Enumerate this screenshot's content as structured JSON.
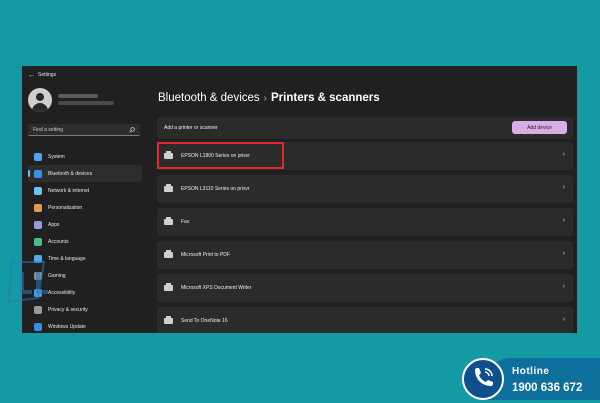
{
  "window": {
    "title": "Settings",
    "back_icon": "←"
  },
  "sidebar": {
    "search_placeholder": "Find a setting",
    "items": [
      {
        "label": "System",
        "icon_color": "#4fa3f7"
      },
      {
        "label": "Bluetooth & devices",
        "icon_color": "#3a8ee6",
        "active": true
      },
      {
        "label": "Network & internet",
        "icon_color": "#6ec0f5"
      },
      {
        "label": "Personalization",
        "icon_color": "#e59a4a"
      },
      {
        "label": "Apps",
        "icon_color": "#9a9ad8"
      },
      {
        "label": "Accounts",
        "icon_color": "#45c08b"
      },
      {
        "label": "Time & language",
        "icon_color": "#57a8e8"
      },
      {
        "label": "Gaming",
        "icon_color": "#8c8c8c"
      },
      {
        "label": "Accessibility",
        "icon_color": "#4d9de0"
      },
      {
        "label": "Privacy & security",
        "icon_color": "#9a9a9a"
      },
      {
        "label": "Windows Update",
        "icon_color": "#2f8fe0"
      }
    ]
  },
  "main": {
    "breadcrumb_parent": "Bluetooth & devices",
    "breadcrumb_separator": "›",
    "breadcrumb_current": "Printers & scanners",
    "add_label": "Add a printer or scanner",
    "add_button": "Add device",
    "devices": [
      {
        "name": "EPSON L1800 Series on prisvr"
      },
      {
        "name": "EPSON L3110 Series on prisvr"
      },
      {
        "name": "Fax"
      },
      {
        "name": "Microsoft Print to PDF"
      },
      {
        "name": "Microsoft XPS Document Writer"
      },
      {
        "name": "Send To OneNote 16"
      }
    ]
  },
  "overlay": {
    "hotline_title": "Hotline",
    "hotline_number": "1900 636 672",
    "accent_color": "#e0282e"
  }
}
